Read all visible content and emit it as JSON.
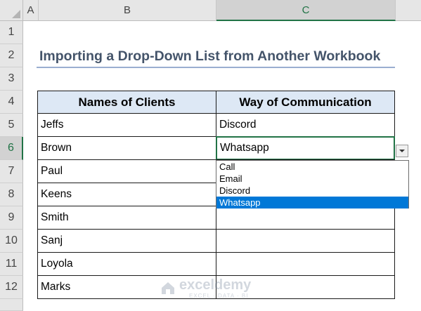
{
  "columns": [
    "A",
    "B",
    "C"
  ],
  "rows": [
    "1",
    "2",
    "3",
    "4",
    "5",
    "6",
    "7",
    "8",
    "9",
    "10",
    "11",
    "12"
  ],
  "title": "Importing a Drop-Down List from Another Workbook",
  "table": {
    "headers": [
      "Names of Clients",
      "Way of Communication"
    ],
    "rows": [
      {
        "name": "Jeffs",
        "way": "Discord"
      },
      {
        "name": "Brown",
        "way": "Whatsapp"
      },
      {
        "name": "Paul",
        "way": ""
      },
      {
        "name": "Keens",
        "way": ""
      },
      {
        "name": "Smith",
        "way": ""
      },
      {
        "name": "Sanj",
        "way": ""
      },
      {
        "name": "Loyola",
        "way": ""
      },
      {
        "name": "Marks",
        "way": ""
      }
    ]
  },
  "dropdown": {
    "options": [
      "Call",
      "Email",
      "Discord",
      "Whatsapp"
    ],
    "selected": "Whatsapp"
  },
  "watermark": {
    "name": "exceldemy",
    "tagline": "EXCEL · DATA · BI"
  },
  "colors": {
    "accent": "#217346",
    "header_fill": "#dde8f5",
    "title": "#44546a",
    "selection": "#0078d7"
  }
}
